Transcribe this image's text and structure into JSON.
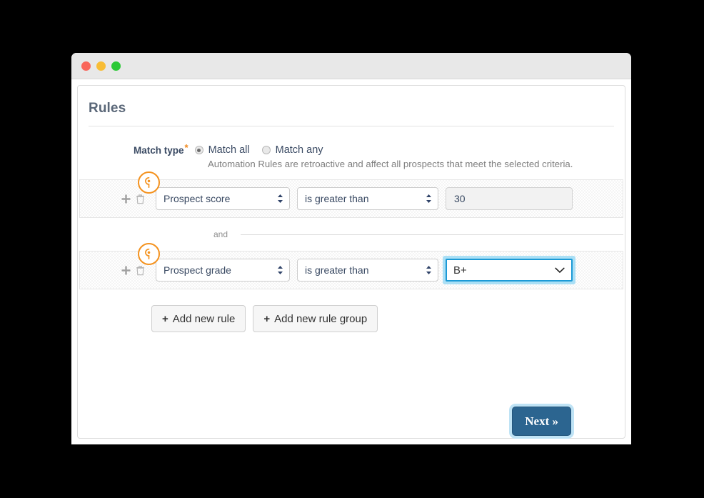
{
  "window": {
    "traffic_lights": [
      "close",
      "minimize",
      "maximize"
    ]
  },
  "card": {
    "title": "Rules"
  },
  "match_type": {
    "label": "Match type",
    "required_marker": "*",
    "options": [
      {
        "label": "Match all",
        "selected": true
      },
      {
        "label": "Match any",
        "selected": false
      }
    ],
    "helper_text": "Automation Rules are retroactive and affect all prospects that meet the selected criteria."
  },
  "rules": [
    {
      "add_icon": "plus-icon",
      "delete_icon": "trash-icon",
      "pin_icon": "map-pin-icon",
      "field": "Prospect score",
      "operator": "is greater than",
      "value": "30",
      "value_type": "text"
    },
    {
      "add_icon": "plus-icon",
      "delete_icon": "trash-icon",
      "pin_icon": "map-pin-icon",
      "field": "Prospect grade",
      "operator": "is greater than",
      "value": "B+",
      "value_type": "select",
      "focused": true
    }
  ],
  "joiner": {
    "label": "and"
  },
  "actions": {
    "add_rule_label": "Add new rule",
    "add_rule_group_label": "Add new rule group",
    "plus_glyph": "+",
    "next_label": "Next »"
  },
  "colors": {
    "accent_orange": "#f4921e",
    "focus_blue": "#1c9ad6",
    "focus_halo": "#aadff5",
    "primary_button": "#2c6590",
    "heading": "#5a6778",
    "required": "#f0871a"
  }
}
